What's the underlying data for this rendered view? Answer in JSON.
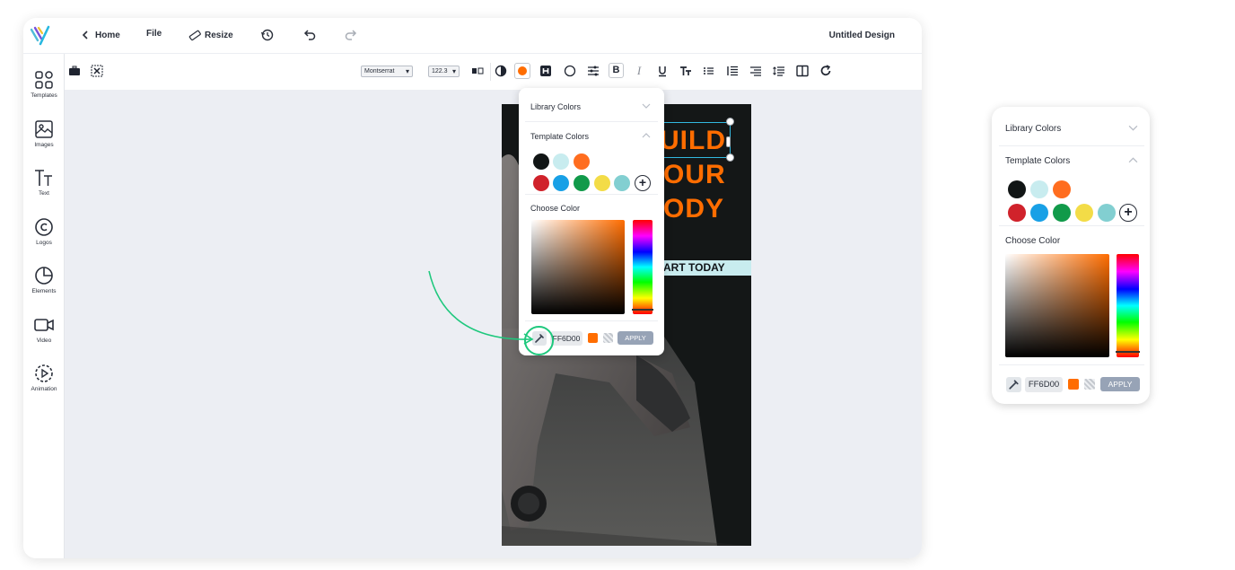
{
  "topbar": {
    "home_label": "Home",
    "file_label": "File",
    "resize_label": "Resize",
    "document_title": "Untitled Design"
  },
  "sidebar": {
    "items": [
      {
        "label": "Templates",
        "icon": "templates-icon"
      },
      {
        "label": "Images",
        "icon": "images-icon"
      },
      {
        "label": "Text",
        "icon": "text-icon"
      },
      {
        "label": "Logos",
        "icon": "copyright-icon"
      },
      {
        "label": "Elements",
        "icon": "elements-icon"
      },
      {
        "label": "Video",
        "icon": "video-icon"
      },
      {
        "label": "Animation",
        "icon": "animation-icon"
      }
    ]
  },
  "toolbar": {
    "font_family": "Montserrat",
    "font_size": "122.3",
    "current_color": "#FF6D00"
  },
  "poster": {
    "line1": "UILD",
    "line2": "OUR",
    "line3": "ODY",
    "cta": "ART TODAY"
  },
  "color_picker": {
    "library_colors_label": "Library Colors",
    "template_colors_label": "Template Colors",
    "choose_color_label": "Choose Color",
    "hex_value": "FF6D00",
    "apply_label": "APPLY",
    "swatches_row1": [
      "#111515",
      "#c8ecef",
      "#ff6d1f"
    ],
    "swatches_row2": [
      "#d0222b",
      "#18a0e6",
      "#119a4a",
      "#f3dc47",
      "#82cfd1"
    ],
    "accent": "#FF6D00",
    "annotation_color": "#1ec87d"
  }
}
